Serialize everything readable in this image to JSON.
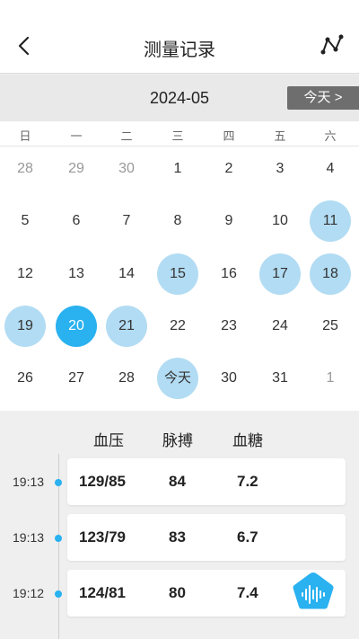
{
  "nav": {
    "title": "测量记录"
  },
  "calendar": {
    "month": "2024-05",
    "today_button": "今天 >",
    "weekdays": [
      "日",
      "一",
      "二",
      "三",
      "四",
      "五",
      "六"
    ],
    "rows": [
      [
        "28",
        "29",
        "30",
        "1",
        "2",
        "3",
        "4"
      ],
      [
        "5",
        "6",
        "7",
        "8",
        "9",
        "10",
        "11"
      ],
      [
        "12",
        "13",
        "14",
        "15",
        "16",
        "17",
        "18"
      ],
      [
        "19",
        "20",
        "21",
        "22",
        "23",
        "24",
        "25"
      ],
      [
        "26",
        "27",
        "28",
        "今天",
        "30",
        "31",
        "1"
      ]
    ],
    "muted_days": [
      "0-0",
      "0-1",
      "0-2",
      "4-6"
    ],
    "marked_days": [
      "1-6",
      "2-3",
      "2-5",
      "2-6",
      "3-0",
      "3-2",
      "4-3"
    ],
    "selected_day": "3-1",
    "colors": {
      "marked": "#b2dcf3",
      "selected": "#29b1f0"
    }
  },
  "records": {
    "headers": {
      "bp": "血压",
      "pulse": "脉搏",
      "sugar": "血糖"
    },
    "items": [
      {
        "time": "19:13",
        "bp": "129/85",
        "pulse": "84",
        "sugar": "7.2"
      },
      {
        "time": "19:13",
        "bp": "123/79",
        "pulse": "83",
        "sugar": "6.7"
      },
      {
        "time": "19:12",
        "bp": "124/81",
        "pulse": "80",
        "sugar": "7.4"
      }
    ]
  },
  "fab": {
    "icon": "voice-wave-icon",
    "color": "#29b1f0"
  }
}
